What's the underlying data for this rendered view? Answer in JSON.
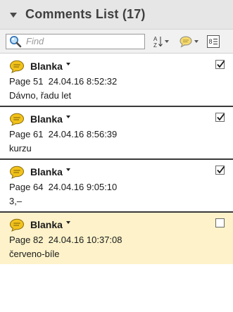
{
  "header": {
    "title": "Comments List (17)"
  },
  "toolbar": {
    "search_placeholder": "Find",
    "search_value": ""
  },
  "comments": [
    {
      "author": "Blanka",
      "page": "Page 51",
      "timestamp": "24.04.16 8:52:32",
      "text": "Dávno, řadu let",
      "checked": true
    },
    {
      "author": "Blanka",
      "page": "Page 61",
      "timestamp": "24.04.16 8:56:39",
      "text": "kurzu",
      "checked": true
    },
    {
      "author": "Blanka",
      "page": "Page 64",
      "timestamp": "24.04.16 9:05:10",
      "text": "3,–",
      "checked": true
    },
    {
      "author": "Blanka",
      "page": "Page 82",
      "timestamp": "24.04.16 10:37:08",
      "text": "červeno-bíle",
      "checked": false,
      "selected": true
    }
  ],
  "colors": {
    "header_bg": "#e6e6e6",
    "selected_bg": "#fdf2c9",
    "comment_icon": "#f2c21b"
  },
  "icons": {
    "search": "search-icon",
    "sort": "sort-icon",
    "comment_filter": "comment-filter-icon",
    "options": "options-icon",
    "comment": "comment-bubble-icon",
    "checkbox": "checkbox-icon"
  }
}
